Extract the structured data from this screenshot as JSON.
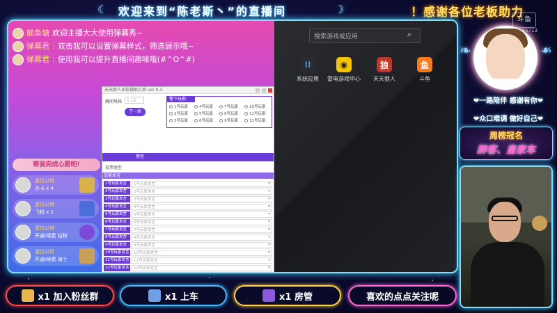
{
  "banner": {
    "welcome_text": "欢迎来到“陈老斯丶”的直播间",
    "thanks_text": "！感谢各位老板助力",
    "watermark": "斗鱼",
    "watermark_id": "7065713"
  },
  "chat": [
    {
      "name": "毓鱼塘",
      "message": "欢迎主播大大使用弹幕秀~"
    },
    {
      "name": "弹幕君",
      "message": "双击我可以设置弹幕样式，筛选展示哦~"
    },
    {
      "name": "弹幕君",
      "message": "使用我可以提升直播间趣味哦(#^O^#)"
    }
  ],
  "desktop": {
    "search_placeholder": "搜索游戏或应用",
    "apps": [
      {
        "label": "系统应用",
        "icon": "grid-icon",
        "color": "#2a2c30"
      },
      {
        "label": "雷电游戏中心",
        "icon": "gamepad-icon",
        "color": "#f5c400"
      },
      {
        "label": "天天狼人",
        "icon": "werewolf-icon",
        "color": "#c0392b"
      },
      {
        "label": "斗鱼",
        "icon": "douyu-icon",
        "color": "#f47b20"
      }
    ]
  },
  "tool": {
    "title": "天天狼人多轮辅助工具 ver 0.3",
    "room_code_label": "房间号码",
    "room_code_value": "1 12",
    "next_button": "下一局",
    "player_section": "警下玩家:",
    "players": [
      "1号玩家",
      "4号玩家",
      "7号玩家",
      "10号玩家",
      "2号玩家",
      "5号玩家",
      "8号玩家",
      "11号玩家",
      "3号玩家",
      "6号玩家",
      "9号玩家",
      "12号玩家"
    ],
    "section_vote": "票型",
    "section_type": "投票类型",
    "section_speech": "玩家发言",
    "rows": [
      {
        "tag": "1号玩家发言",
        "placeholder": "1号玩家发言"
      },
      {
        "tag": "2号玩家发言",
        "placeholder": "2号玩家发言"
      },
      {
        "tag": "3号玩家发言",
        "placeholder": "3号玩家发言"
      },
      {
        "tag": "4号玩家发言",
        "placeholder": "4号玩家发言"
      },
      {
        "tag": "5号玩家发言",
        "placeholder": "5号玩家发言"
      },
      {
        "tag": "6号玩家发言",
        "placeholder": "6号玩家发言"
      },
      {
        "tag": "7号玩家发言",
        "placeholder": "7号玩家发言"
      },
      {
        "tag": "8号玩家发言",
        "placeholder": "8号玩家发言"
      },
      {
        "tag": "9号玩家发言",
        "placeholder": "9号玩家发言"
      },
      {
        "tag": "10号玩家发言",
        "placeholder": "10号玩家发言"
      },
      {
        "tag": "11号玩家发言",
        "placeholder": "11号玩家发言"
      },
      {
        "tag": "12号玩家发言",
        "placeholder": "12号玩家发言"
      }
    ]
  },
  "gifts": {
    "header": "帮我完成心愿吧!",
    "items": [
      {
        "user": "虚位以待",
        "gift": "办卡 x 4",
        "color": "#d9b24a"
      },
      {
        "user": "虚位以待",
        "gift": "飞机 x 1",
        "color": "#4a6fd9"
      },
      {
        "user": "虚位以待",
        "gift": "开通/续费 钻粉",
        "color": "#7a4ad9"
      },
      {
        "user": "虚位以待",
        "gift": "开通/续费 骑士",
        "color": "#c9a05a"
      }
    ]
  },
  "right": {
    "slogan1": "❤一路陪伴 感谢有你❤",
    "slogan2": "❤众口难调 做好自己❤",
    "rank_title": "周榜冠名",
    "rank_names": "辞客、皇家车"
  },
  "bottom": {
    "btn1": "x1 加入粉丝群",
    "btn2": "x1 上车",
    "btn3": "x1 房管",
    "btn4": "喜欢的点点关注呢"
  }
}
